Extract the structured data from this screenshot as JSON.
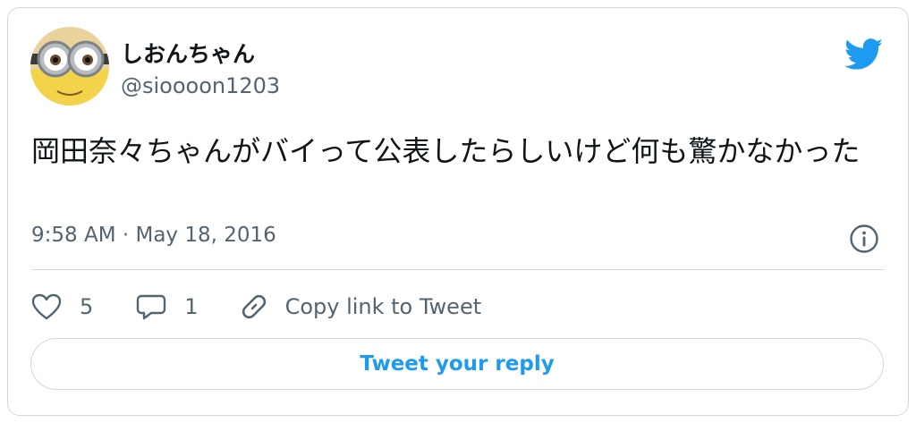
{
  "tweet": {
    "author": {
      "display_name": "しおんちゃん",
      "handle": "@sioooon1203",
      "avatar_icon": "minion-avatar"
    },
    "brand_icon": "twitter-bird-icon",
    "text": "岡田奈々ちゃんがバイって公表したらしいけど何も驚かなかった",
    "timestamp": "9:58 AM · May 18, 2016",
    "info_icon": "info-icon"
  },
  "actions": {
    "like": {
      "icon": "heart-icon",
      "count": "5"
    },
    "reply": {
      "icon": "speech-bubble-icon",
      "count": "1"
    },
    "copy_link": {
      "icon": "link-icon",
      "label": "Copy link to Tweet"
    }
  },
  "reply_button": {
    "label": "Tweet your reply"
  },
  "colors": {
    "accent": "#1d9bf0",
    "text": "#0f1419",
    "secondary": "#536471",
    "border": "#cfd9de"
  }
}
